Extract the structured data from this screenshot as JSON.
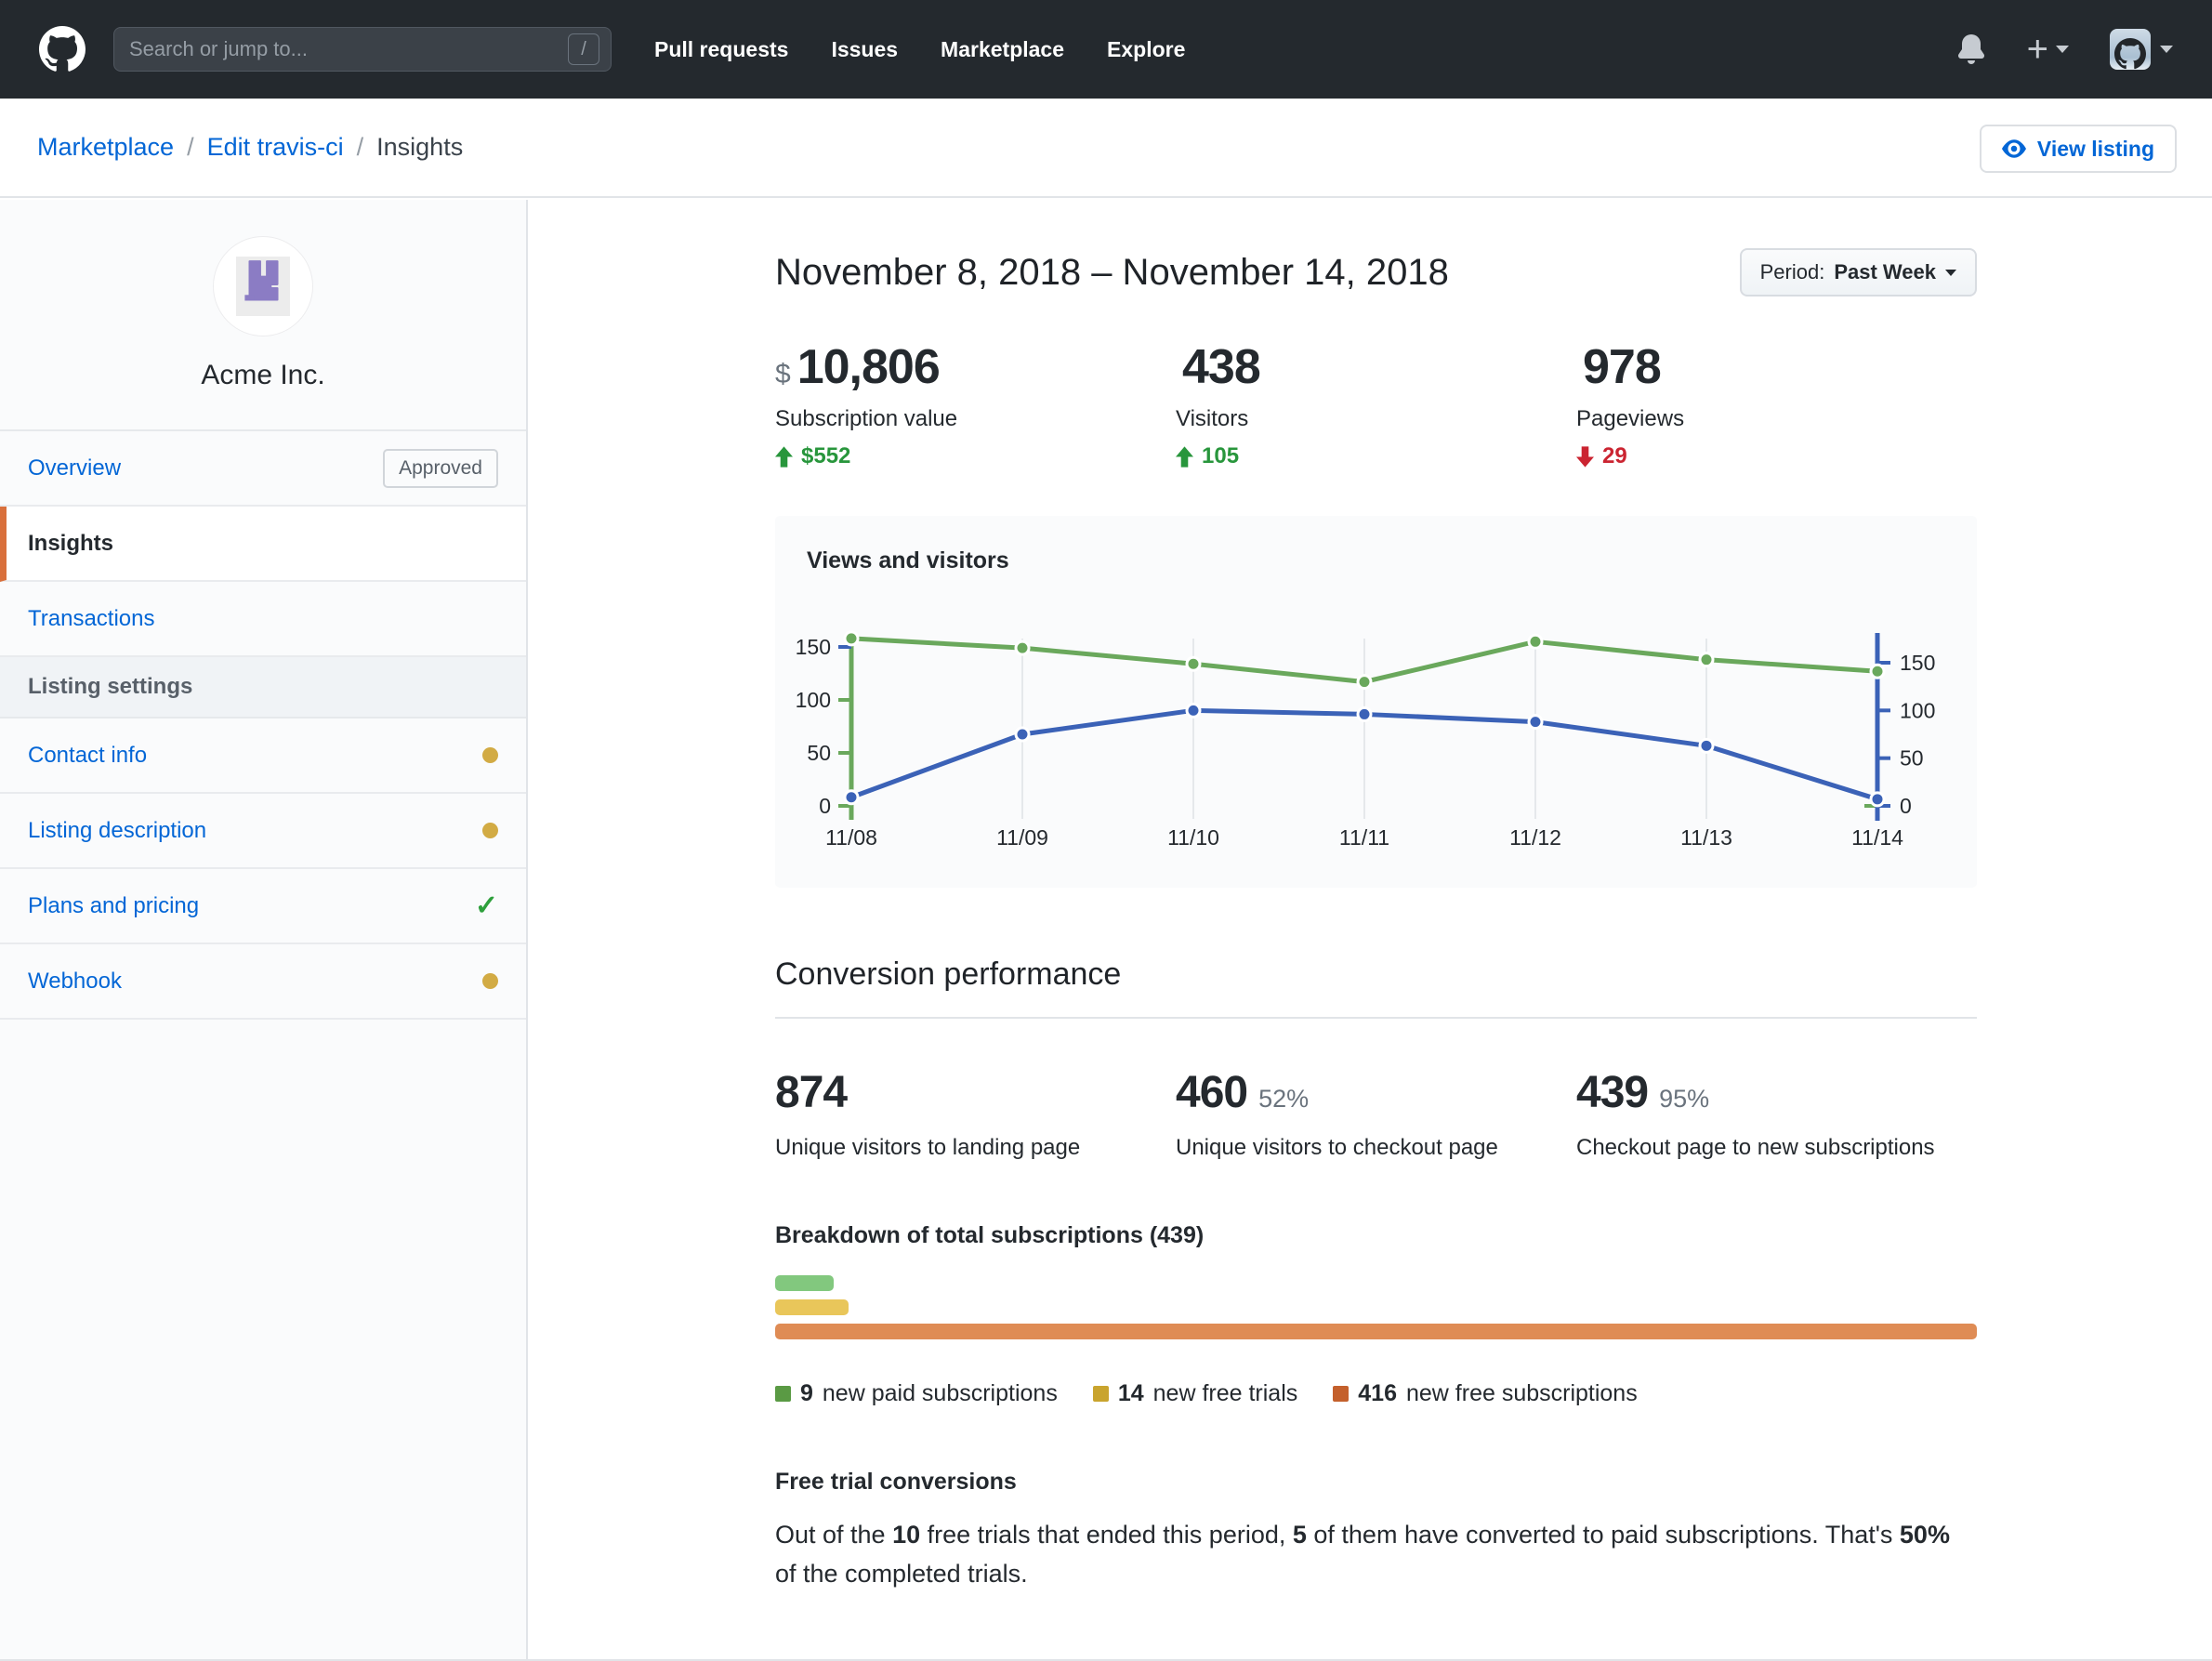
{
  "header": {
    "search_placeholder": "Search or jump to...",
    "search_key_hint": "/",
    "nav": [
      "Pull requests",
      "Issues",
      "Marketplace",
      "Explore"
    ]
  },
  "breadcrumb": {
    "link1": "Marketplace",
    "link2": "Edit travis-ci",
    "current": "Insights"
  },
  "view_listing_label": "View listing",
  "sidebar": {
    "org_name": "Acme Inc.",
    "menu": [
      {
        "label": "Overview",
        "badge": "Approved"
      },
      {
        "label": "Insights",
        "selected": true
      },
      {
        "label": "Transactions"
      }
    ],
    "settings_heading": "Listing settings",
    "settings_items": [
      {
        "label": "Contact info",
        "status": "pending"
      },
      {
        "label": "Listing description",
        "status": "pending"
      },
      {
        "label": "Plans and pricing",
        "status": "complete"
      },
      {
        "label": "Webhook",
        "status": "pending"
      }
    ]
  },
  "main": {
    "date_range": "November 8, 2018 – November 14, 2018",
    "period_label": "Period:",
    "period_value": "Past Week",
    "stats": [
      {
        "prefix": "$",
        "value": "10,806",
        "label": "Subscription value",
        "delta": "$552",
        "direction": "up"
      },
      {
        "value": "438",
        "label": "Visitors",
        "delta": "105",
        "direction": "up"
      },
      {
        "value": "978",
        "label": "Pageviews",
        "delta": "29",
        "direction": "down"
      }
    ],
    "conversion": {
      "heading": "Conversion performance",
      "stats": [
        {
          "value": "874",
          "pct": "",
          "label": "Unique visitors to landing page"
        },
        {
          "value": "460",
          "pct": "52%",
          "label": "Unique visitors to checkout page"
        },
        {
          "value": "439",
          "pct": "95%",
          "label": "Checkout page to new subscriptions"
        }
      ]
    },
    "breakdown": {
      "heading": "Breakdown of total subscriptions (439)",
      "bars": [
        {
          "name": "new paid subscriptions",
          "value": 9,
          "color": "#82c87e",
          "width_pct": 4.9
        },
        {
          "name": "new free trials",
          "value": 14,
          "color": "#e9c65a",
          "width_pct": 6.1
        },
        {
          "name": "new free subscriptions",
          "value": 416,
          "color": "#df8c55",
          "width_pct": 100
        }
      ],
      "legend": [
        {
          "count": "9",
          "text": "new paid subscriptions",
          "color": "#5a9a44"
        },
        {
          "count": "14",
          "text": "new free trials",
          "color": "#c9a42e"
        },
        {
          "count": "416",
          "text": "new free subscriptions",
          "color": "#c4602c"
        }
      ]
    },
    "free_trial": {
      "heading": "Free trial conversions",
      "segments": [
        {
          "text": "Out of the "
        },
        {
          "text": "10",
          "bold": true
        },
        {
          "text": " free trials that ended this period, "
        },
        {
          "text": "5",
          "bold": true
        },
        {
          "text": " of them have converted to paid subscriptions. That's "
        },
        {
          "text": "50%",
          "bold": true
        },
        {
          "text": " of the completed trials."
        }
      ]
    }
  },
  "chart_data": {
    "type": "line",
    "title": "Views and visitors",
    "x": [
      "11/08",
      "11/09",
      "11/10",
      "11/11",
      "11/12",
      "11/13",
      "11/14"
    ],
    "series": [
      {
        "name": "Views",
        "axis": "left",
        "color": "#6aa85c",
        "values": [
          158,
          149,
          134,
          117,
          155,
          138,
          127
        ]
      },
      {
        "name": "Visitors",
        "axis": "right",
        "color": "#3b62b7",
        "values": [
          9,
          75,
          100,
          96,
          88,
          63,
          7
        ]
      }
    ],
    "yticks": [
      0,
      50,
      100,
      150
    ],
    "left_axis_range": [
      0,
      158
    ],
    "right_axis_range": [
      0,
      160
    ],
    "grid": true,
    "legend_position": "none"
  }
}
